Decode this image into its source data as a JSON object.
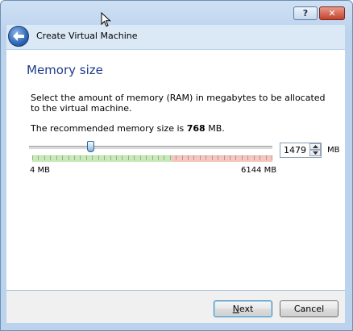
{
  "window": {
    "help_label": "?",
    "close_label": "✕",
    "title": "Create Virtual Machine"
  },
  "page": {
    "section_title": "Memory size",
    "description": "Select the amount of memory (RAM) in megabytes to be allocated to the virtual machine.",
    "recommended_prefix": "The recommended memory size is ",
    "recommended_value": "768",
    "recommended_suffix": " MB."
  },
  "memory": {
    "min": 4,
    "max": 6144,
    "value": 1479,
    "recommended_green_fraction": 0.58,
    "min_label": "4 MB",
    "max_label": "6144 MB",
    "value_text": "1479",
    "unit": "MB"
  },
  "buttons": {
    "next_label": "Next",
    "next_mnemonic": "N",
    "next_rest": "ext",
    "cancel_label": "Cancel"
  },
  "icons": {
    "back": "back-arrow-icon",
    "cursor": "mouse-pointer-icon",
    "spin_up": "chevron-up-icon",
    "spin_down": "chevron-down-icon"
  },
  "colors": {
    "title_blue": "#1e3c8a",
    "safe_green": "#c8eab8",
    "warn_red": "#f6c6c0",
    "frame": "#bcd3ee"
  }
}
